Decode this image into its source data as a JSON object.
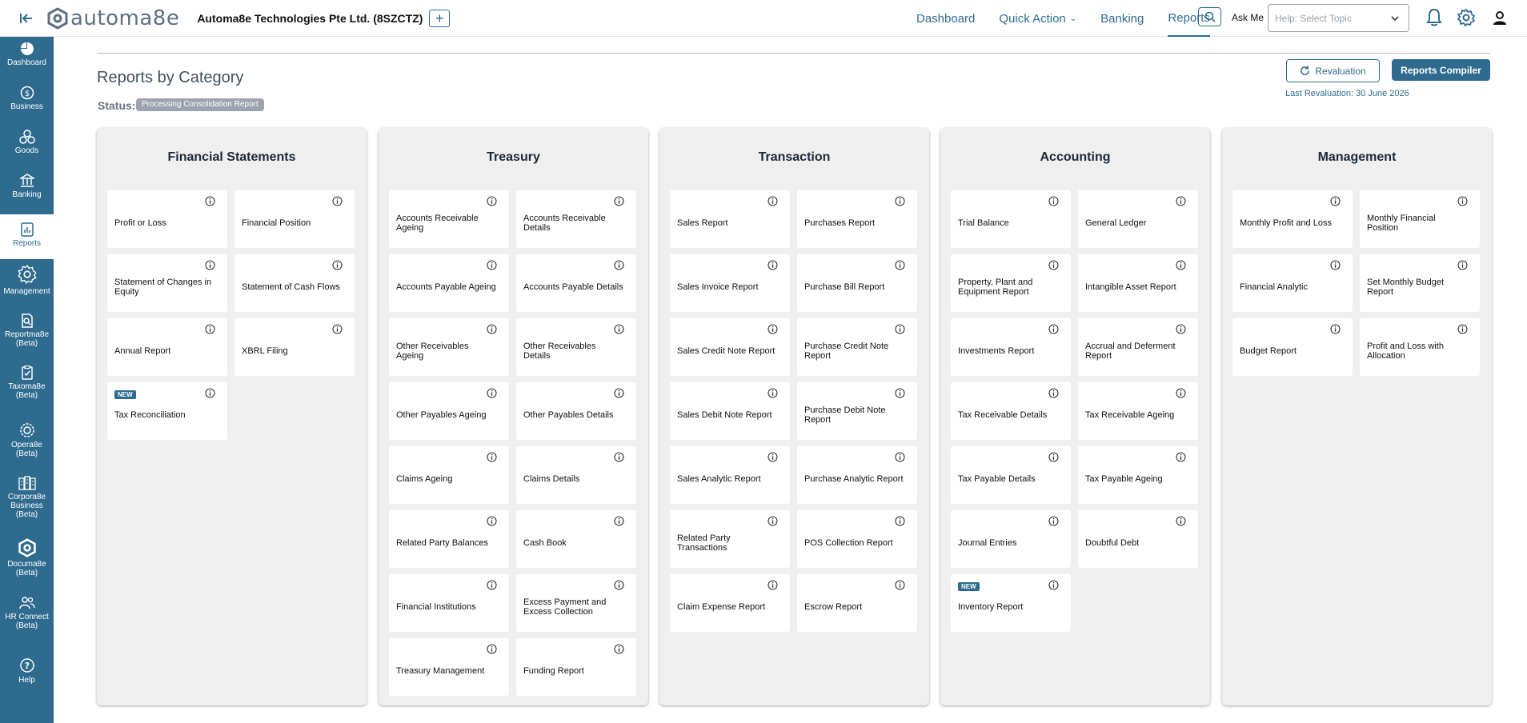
{
  "header": {
    "logo_text": "automa8e",
    "company_name": "Automa8e Technologies Pte Ltd. (8SZCTZ)",
    "add_symbol": "+",
    "nav": [
      {
        "label": "Dashboard"
      },
      {
        "label": "Quick Action",
        "has_dropdown": true
      },
      {
        "label": "Banking"
      },
      {
        "label": "Reports",
        "active": true
      }
    ],
    "ask_me_label": "Ask Me",
    "help_placeholder": "Help: Select Topic"
  },
  "sidebar": {
    "items": [
      {
        "label": "Dashboard",
        "icon": "pie-chart-icon"
      },
      {
        "label": "Business",
        "icon": "dollar-icon"
      },
      {
        "label": "Goods",
        "icon": "boxes-icon"
      },
      {
        "label": "Banking",
        "icon": "bank-icon"
      },
      {
        "label": "Reports",
        "icon": "report-icon",
        "active": true
      },
      {
        "label": "Management",
        "icon": "gear-icon"
      },
      {
        "label": "Reportma8e (Beta)",
        "icon": "search-doc-icon"
      },
      {
        "label": "Taxoma8e (Beta)",
        "icon": "clipboard-icon"
      },
      {
        "label": "Opera8e (Beta)",
        "icon": "globe-icon"
      },
      {
        "label": "Corpora8e Business (Beta)",
        "icon": "building-icon"
      },
      {
        "label": "Documa8e (Beta)",
        "icon": "logo-icon"
      },
      {
        "label": "HR Connect (Beta)",
        "icon": "people-icon"
      },
      {
        "label": "Help",
        "icon": "question-icon"
      }
    ]
  },
  "page": {
    "title": "Reports by Category",
    "status_label": "Status:",
    "status_value": "Processing Consolidation Report",
    "revaluation_button": "Revaluation",
    "compiler_button": "Reports Compiler",
    "last_revaluation": "Last Revaluation: 30 June 2026",
    "new_badge": "NEW"
  },
  "categories": [
    {
      "title": "Financial Statements",
      "reports": [
        {
          "label": "Profit or Loss"
        },
        {
          "label": "Financial Position"
        },
        {
          "label": "Statement of Changes in Equity"
        },
        {
          "label": "Statement of Cash Flows"
        },
        {
          "label": "Annual Report"
        },
        {
          "label": "XBRL Filing"
        },
        {
          "label": "Tax Reconciliation",
          "new": true
        }
      ]
    },
    {
      "title": "Treasury",
      "reports": [
        {
          "label": "Accounts Receivable Ageing"
        },
        {
          "label": "Accounts Receivable Details"
        },
        {
          "label": "Accounts Payable Ageing"
        },
        {
          "label": "Accounts Payable Details"
        },
        {
          "label": "Other Receivables Ageing"
        },
        {
          "label": "Other Receivables Details"
        },
        {
          "label": "Other Payables Ageing"
        },
        {
          "label": "Other Payables Details"
        },
        {
          "label": "Claims Ageing"
        },
        {
          "label": "Claims Details"
        },
        {
          "label": "Related Party Balances"
        },
        {
          "label": "Cash Book"
        },
        {
          "label": "Financial Institutions"
        },
        {
          "label": "Excess Payment and Excess Collection"
        },
        {
          "label": "Treasury Management"
        },
        {
          "label": "Funding Report"
        }
      ]
    },
    {
      "title": "Transaction",
      "reports": [
        {
          "label": "Sales Report"
        },
        {
          "label": "Purchases Report"
        },
        {
          "label": "Sales Invoice Report"
        },
        {
          "label": "Purchase Bill Report"
        },
        {
          "label": "Sales Credit Note Report"
        },
        {
          "label": "Purchase Credit Note Report"
        },
        {
          "label": "Sales Debit Note Report"
        },
        {
          "label": "Purchase Debit Note Report"
        },
        {
          "label": "Sales Analytic Report"
        },
        {
          "label": "Purchase Analytic Report"
        },
        {
          "label": "Related Party Transactions"
        },
        {
          "label": "POS Collection Report"
        },
        {
          "label": "Claim Expense Report"
        },
        {
          "label": "Escrow Report"
        }
      ]
    },
    {
      "title": "Accounting",
      "reports": [
        {
          "label": "Trial Balance"
        },
        {
          "label": "General Ledger"
        },
        {
          "label": "Property, Plant and Equipment Report"
        },
        {
          "label": "Intangible Asset Report"
        },
        {
          "label": "Investments Report"
        },
        {
          "label": "Accrual and Deferment Report"
        },
        {
          "label": "Tax Receivable Details"
        },
        {
          "label": "Tax Receivable Ageing"
        },
        {
          "label": "Tax Payable Details"
        },
        {
          "label": "Tax Payable Ageing"
        },
        {
          "label": "Journal Entries"
        },
        {
          "label": "Doubtful Debt"
        },
        {
          "label": "Inventory Report",
          "new": true
        }
      ]
    },
    {
      "title": "Management",
      "reports": [
        {
          "label": "Monthly Profit and Loss"
        },
        {
          "label": "Monthly Financial Position"
        },
        {
          "label": "Financial Analytic"
        },
        {
          "label": "Set Monthly Budget Report"
        },
        {
          "label": "Budget Report"
        },
        {
          "label": "Profit and Loss with Allocation"
        }
      ]
    }
  ],
  "colors": {
    "brand": "#2e6b8f",
    "panel_bg": "#f0eff0",
    "badge_gray": "#9ca3af"
  }
}
